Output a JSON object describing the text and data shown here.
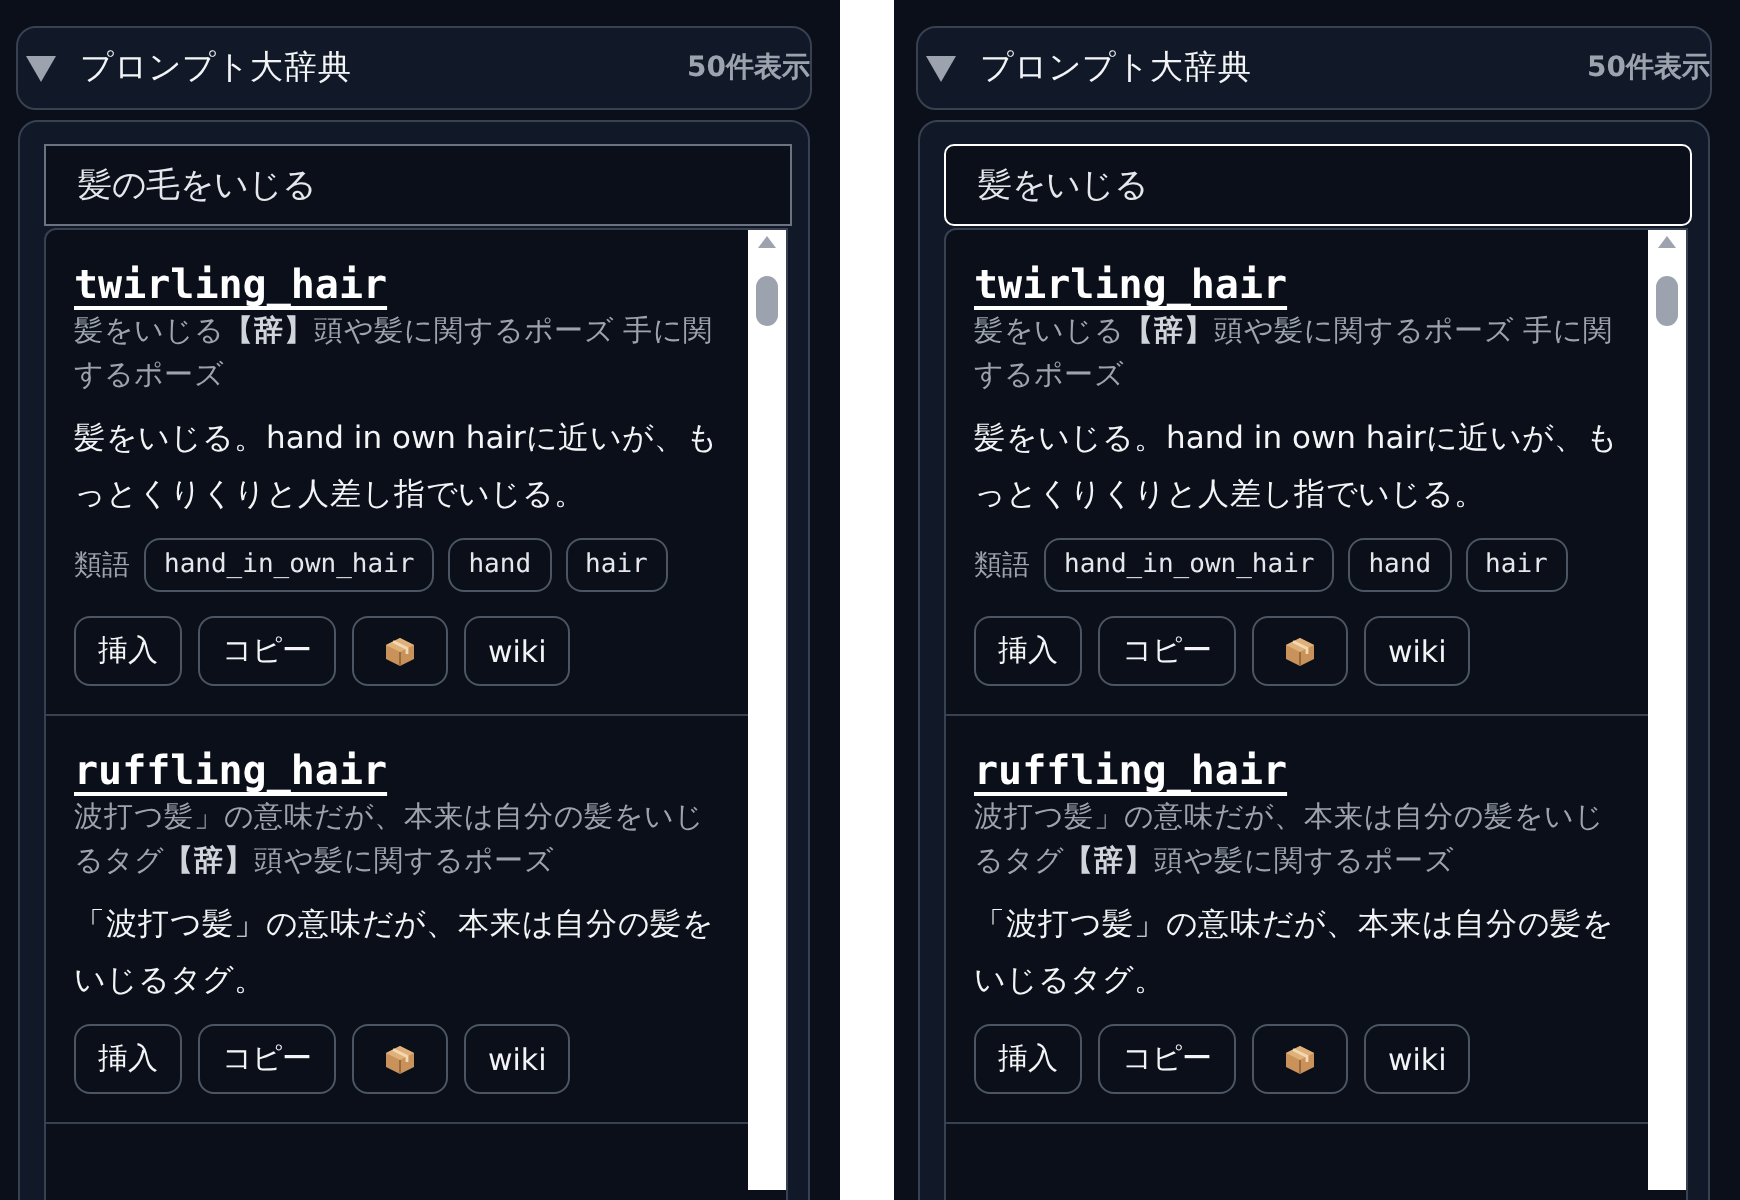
{
  "panels": [
    {
      "title": "プロンプト大辞典",
      "count": "50件表示",
      "expanded": true,
      "search": {
        "value": "髪の毛をいじる",
        "focused": false
      },
      "entries": [
        {
          "tag": "twirling_hair",
          "subtitle": "髪をいじる**【辞】**頭や髪に関するポーズ 手に関するポーズ",
          "description": "髪をいじる。hand in own hairに近いが、もっとくりくりと人差し指でいじる。",
          "synonyms_label": "類語",
          "synonyms": [
            "hand_in_own_hair",
            "hand",
            "hair"
          ],
          "buttons": [
            {
              "kind": "text",
              "label": "挿入"
            },
            {
              "kind": "text",
              "label": "コピー"
            },
            {
              "kind": "icon"
            },
            {
              "kind": "text",
              "label": "wiki"
            }
          ]
        },
        {
          "tag": "ruffling_hair",
          "subtitle": "波打つ髪」の意味だが、本来は自分の髪をいじるタグ**【辞】**頭や髪に関するポーズ",
          "description": "「波打つ髪」の意味だが、本来は自分の髪をいじるタグ。",
          "buttons": [
            {
              "kind": "text",
              "label": "挿入"
            },
            {
              "kind": "text",
              "label": "コピー"
            },
            {
              "kind": "icon"
            },
            {
              "kind": "text",
              "label": "wiki"
            }
          ]
        }
      ]
    },
    {
      "title": "プロンプト大辞典",
      "count": "50件表示",
      "expanded": true,
      "search": {
        "value": "髪をいじる",
        "focused": true
      },
      "entries": [
        {
          "tag": "twirling_hair",
          "subtitle": "髪をいじる**【辞】**頭や髪に関するポーズ 手に関するポーズ",
          "description": "髪をいじる。hand in own hairに近いが、もっとくりくりと人差し指でいじる。",
          "synonyms_label": "類語",
          "synonyms": [
            "hand_in_own_hair",
            "hand",
            "hair"
          ],
          "buttons": [
            {
              "kind": "text",
              "label": "挿入"
            },
            {
              "kind": "text",
              "label": "コピー"
            },
            {
              "kind": "icon"
            },
            {
              "kind": "text",
              "label": "wiki"
            }
          ]
        },
        {
          "tag": "ruffling_hair",
          "subtitle": "波打つ髪」の意味だが、本来は自分の髪をいじるタグ**【辞】**頭や髪に関するポーズ",
          "description": "「波打つ髪」の意味だが、本来は自分の髪をいじるタグ。",
          "buttons": [
            {
              "kind": "text",
              "label": "挿入"
            },
            {
              "kind": "text",
              "label": "コピー"
            },
            {
              "kind": "icon"
            },
            {
              "kind": "text",
              "label": "wiki"
            }
          ]
        }
      ]
    }
  ]
}
